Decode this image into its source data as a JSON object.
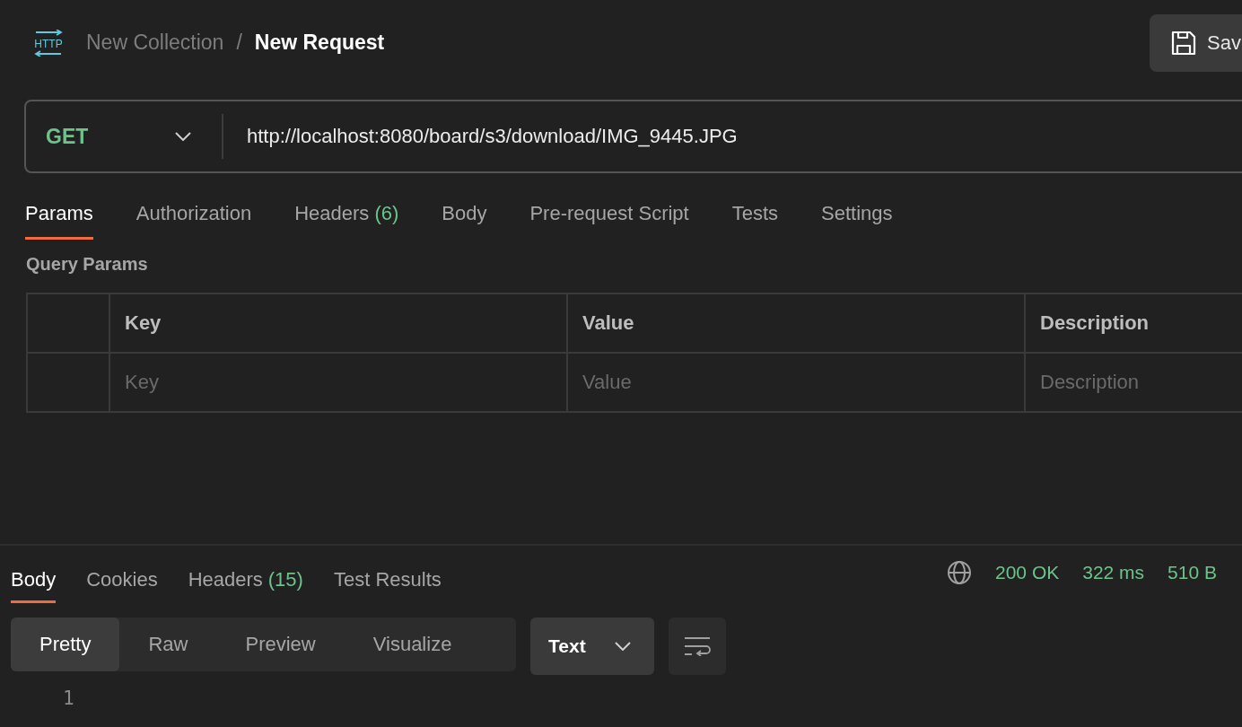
{
  "breadcrumb": {
    "logo": "HTTP",
    "collection": "New Collection",
    "separator": "/",
    "request": "New Request"
  },
  "save_button": {
    "label": "Sav"
  },
  "request": {
    "method": "GET",
    "url": "http://localhost:8080/board/s3/download/IMG_9445.JPG"
  },
  "request_tabs": [
    {
      "label": "Params",
      "selected": true
    },
    {
      "label": "Authorization",
      "selected": false
    },
    {
      "label": "Headers",
      "count": "(6)",
      "selected": false
    },
    {
      "label": "Body",
      "selected": false
    },
    {
      "label": "Pre-request Script",
      "selected": false
    },
    {
      "label": "Tests",
      "selected": false
    },
    {
      "label": "Settings",
      "selected": false
    }
  ],
  "query_params": {
    "title": "Query Params",
    "columns": [
      "Key",
      "Value",
      "Description"
    ],
    "placeholders": [
      "Key",
      "Value",
      "Description"
    ]
  },
  "response_tabs": [
    {
      "label": "Body",
      "selected": true
    },
    {
      "label": "Cookies",
      "selected": false
    },
    {
      "label": "Headers",
      "count": "(15)",
      "selected": false
    },
    {
      "label": "Test Results",
      "selected": false
    }
  ],
  "status": {
    "code": "200 OK",
    "time": "322 ms",
    "size": "510 B"
  },
  "view_modes": [
    {
      "label": "Pretty",
      "selected": true
    },
    {
      "label": "Raw",
      "selected": false
    },
    {
      "label": "Preview",
      "selected": false
    },
    {
      "label": "Visualize",
      "selected": false
    }
  ],
  "format_dropdown": {
    "value": "Text"
  },
  "line_numbers": [
    "1"
  ]
}
